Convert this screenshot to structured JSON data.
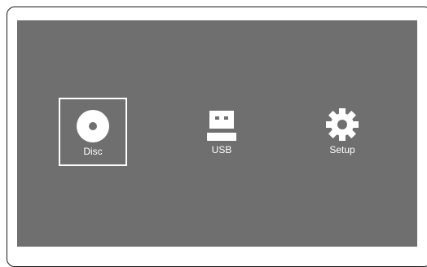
{
  "menu": {
    "items": [
      {
        "label": "Disc",
        "icon": "disc-icon",
        "selected": true
      },
      {
        "label": "USB",
        "icon": "usb-icon",
        "selected": false
      },
      {
        "label": "Setup",
        "icon": "gear-icon",
        "selected": false
      }
    ]
  },
  "colors": {
    "screen_background": "#6f6f6f",
    "foreground": "#ffffff",
    "frame_border": "#1a1a1a"
  }
}
